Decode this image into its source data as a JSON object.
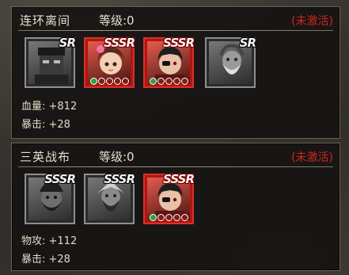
{
  "panels": [
    {
      "name": "连环离间",
      "level": "等级:0",
      "status": "(未激活)",
      "cards": [
        {
          "rarity": "SR",
          "frame": "grey",
          "portrait": "masked-warrior-portrait",
          "stars": false
        },
        {
          "rarity": "SSSR",
          "frame": "red",
          "portrait": "female-hero-portrait",
          "stars": true
        },
        {
          "rarity": "SSSR",
          "frame": "red",
          "portrait": "eyepatch-warrior-portrait",
          "stars": true
        },
        {
          "rarity": "SR",
          "frame": "grey",
          "portrait": "bearded-elder-portrait",
          "stars": false
        }
      ],
      "stats": [
        "血量: +812",
        "暴击: +28"
      ]
    },
    {
      "name": "三英战布",
      "level": "等级:0",
      "status": "(未激活)",
      "cards": [
        {
          "rarity": "SSSR",
          "frame": "grey",
          "portrait": "bearded-general-portrait",
          "stars": false
        },
        {
          "rarity": "SSSR",
          "frame": "grey",
          "portrait": "long-beard-general-portrait",
          "stars": false
        },
        {
          "rarity": "SSSR",
          "frame": "red",
          "portrait": "eyepatch-warrior-portrait",
          "stars": true
        }
      ],
      "stats": [
        "物攻: +112",
        "暴击: +28"
      ]
    }
  ],
  "colors": {
    "status_red": "#d2231e",
    "text": "#e8dfcc",
    "card_red": "#b01513",
    "card_grey": "#8f8f8f",
    "star_green": "#2fa23a"
  }
}
